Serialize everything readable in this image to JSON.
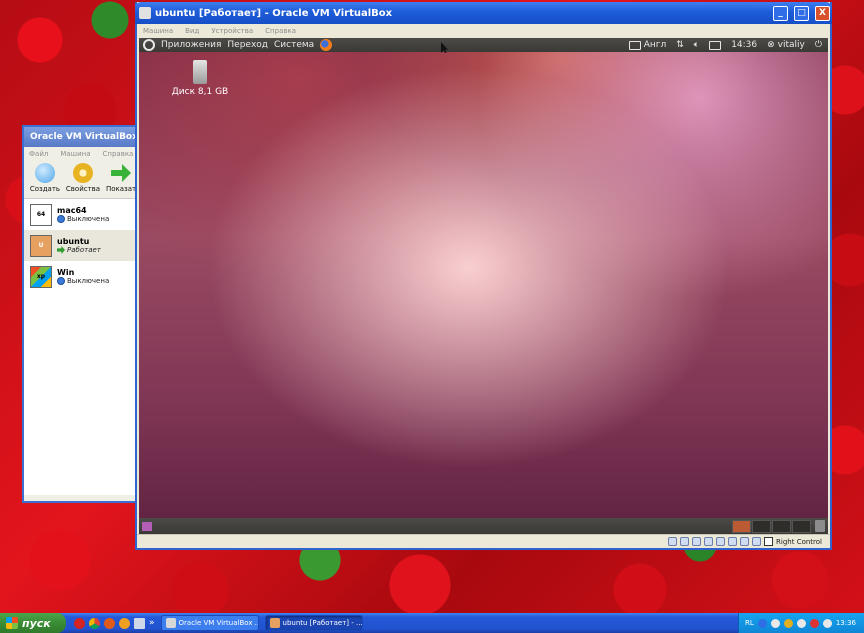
{
  "manager": {
    "title": "Oracle VM VirtualBox M",
    "menu": [
      "Файл",
      "Машина",
      "Справка"
    ],
    "toolbar": [
      {
        "label": "Создать",
        "icon": "create-icon",
        "color": "#4fa6e8"
      },
      {
        "label": "Свойства",
        "icon": "gear-icon",
        "color": "#e8b320"
      },
      {
        "label": "Показат",
        "icon": "show-arrow-icon",
        "color": "#39b23a"
      }
    ],
    "vms": [
      {
        "name": "mac64",
        "state": "Выключена",
        "logo": "64"
      },
      {
        "name": "ubuntu",
        "state": "Работает",
        "logo": "U"
      },
      {
        "name": "Win",
        "state": "Выключена",
        "logo": "xp"
      }
    ]
  },
  "vmwindow": {
    "title": "ubuntu [Работает] - Oracle VM VirtualBox",
    "menu": [
      "Машина",
      "Вид",
      "Устройства",
      "Справка"
    ],
    "minimize": "_",
    "maximize": "□",
    "close": "X",
    "status_hostkey": "Right Control"
  },
  "guest": {
    "panel_menus": [
      "Приложения",
      "Переход",
      "Система"
    ],
    "keyboard_layout": "Англ",
    "clock": "14:36",
    "user": "vitaliy",
    "desktop_icon_label": "Диск 8,1 GB"
  },
  "taskbar": {
    "start_label": "пуск",
    "tasks": [
      "Oracle VM VirtualBox ...",
      "ubuntu [Работает] - ..."
    ],
    "lang": "RL",
    "clock": "13:36",
    "overflow": "»"
  }
}
